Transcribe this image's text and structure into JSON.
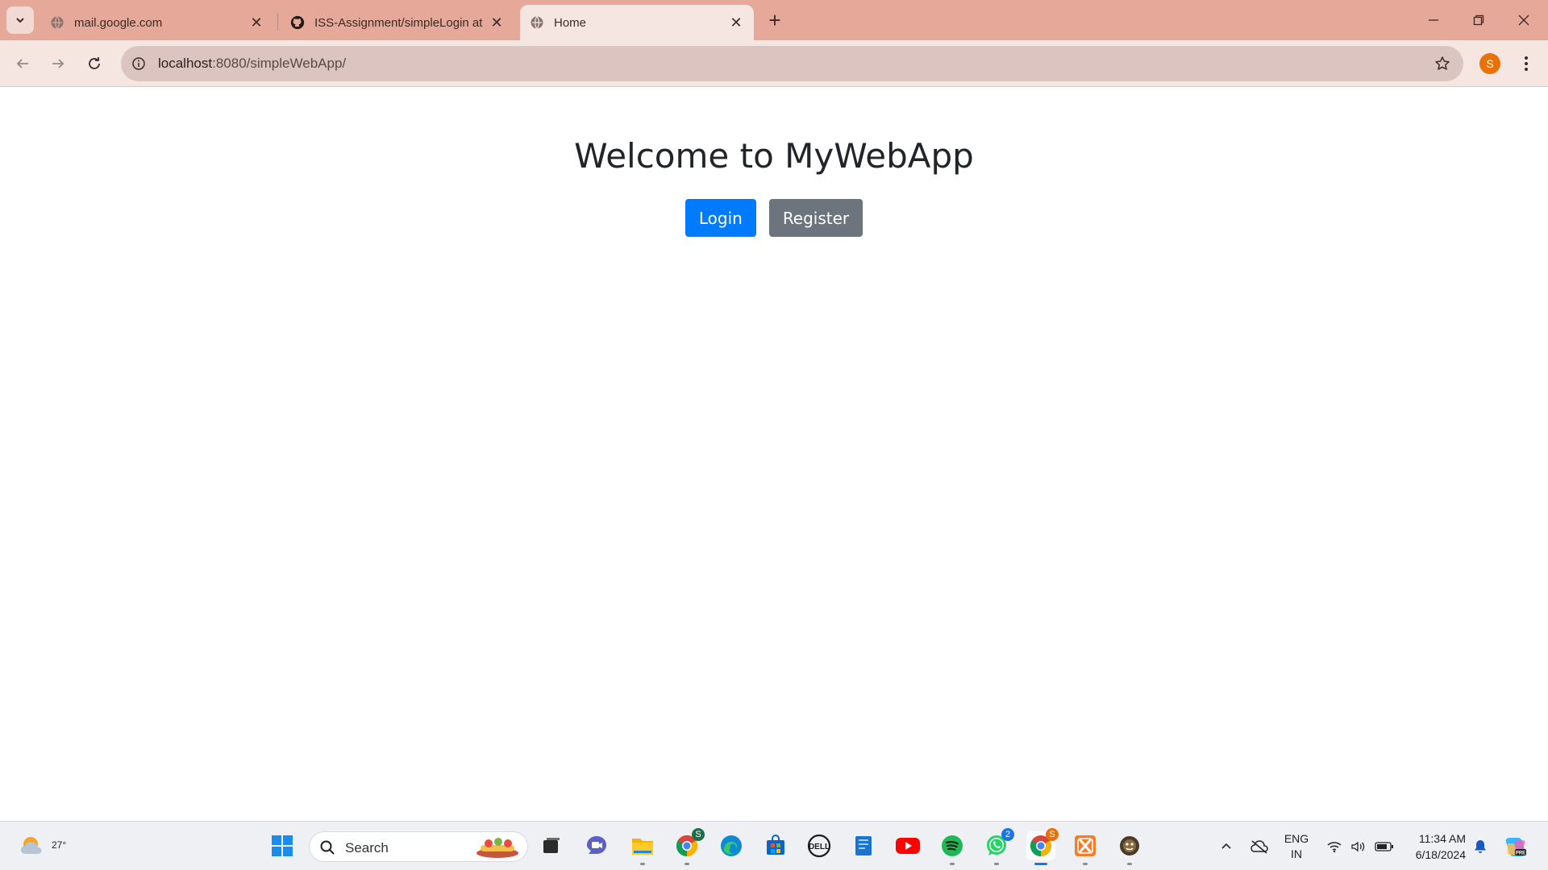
{
  "browser": {
    "tabs": [
      {
        "title": "mail.google.com",
        "favicon": "globe-icon",
        "active": false
      },
      {
        "title": "ISS-Assignment/simpleLogin at",
        "favicon": "github-icon",
        "active": false
      },
      {
        "title": "Home",
        "favicon": "globe-icon",
        "active": true
      }
    ],
    "address": {
      "host": "localhost",
      "path": ":8080/simpleWebApp/"
    },
    "profile_initial": "S",
    "colors": {
      "tabstrip": "#e5a899",
      "toolbar": "#f6e6e2",
      "omnibox": "#dcc5c0",
      "profile": "#e8710a"
    }
  },
  "page": {
    "heading": "Welcome to MyWebApp",
    "buttons": {
      "login": "Login",
      "register": "Register"
    },
    "colors": {
      "login": "#007bff",
      "register": "#6c757d",
      "heading": "#212529"
    }
  },
  "taskbar": {
    "weather_temp": "27°",
    "search_placeholder": "Search",
    "apps": [
      {
        "name": "windows-start-icon"
      },
      {
        "name": "task-view-icon"
      },
      {
        "name": "meet-icon"
      },
      {
        "name": "file-explorer-icon"
      },
      {
        "name": "chrome-profile-icon",
        "badge": "S"
      },
      {
        "name": "edge-icon"
      },
      {
        "name": "store-icon"
      },
      {
        "name": "dell-icon"
      },
      {
        "name": "notes-icon"
      },
      {
        "name": "youtube-icon"
      },
      {
        "name": "spotify-icon"
      },
      {
        "name": "whatsapp-icon",
        "badge": "2"
      },
      {
        "name": "chrome-icon",
        "badge": "S"
      },
      {
        "name": "xampp-icon"
      },
      {
        "name": "app-icon"
      }
    ],
    "tray": {
      "lang_line1": "ENG",
      "lang_line2": "IN",
      "time": "11:34 AM",
      "date": "6/18/2024"
    }
  }
}
